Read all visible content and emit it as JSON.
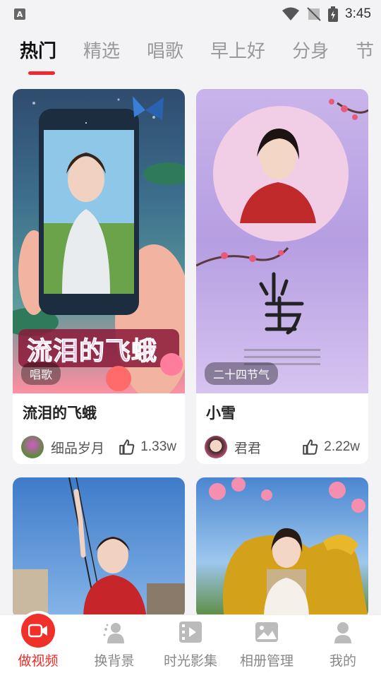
{
  "status_bar": {
    "left_icon": "A",
    "time": "3:45"
  },
  "tabs": [
    {
      "label": "热门",
      "active": true
    },
    {
      "label": "精选",
      "active": false
    },
    {
      "label": "唱歌",
      "active": false
    },
    {
      "label": "早上好",
      "active": false
    },
    {
      "label": "分身",
      "active": false
    },
    {
      "label": "节",
      "active": false
    }
  ],
  "cards": [
    {
      "title": "流泪的飞蛾",
      "tag": "唱歌",
      "author": "细品岁月",
      "likes": "1.33w",
      "overlay_text": "流泪的飞蛾"
    },
    {
      "title": "小雪",
      "tag": "二十四节气",
      "author": "君君",
      "likes": "2.22w",
      "overlay_text": "小雪"
    },
    {
      "title": "",
      "tag": "",
      "author": "",
      "likes": ""
    },
    {
      "title": "",
      "tag": "",
      "author": "",
      "likes": ""
    }
  ],
  "bottom_nav": [
    {
      "label": "做视频",
      "icon": "video-camera-icon",
      "active": true
    },
    {
      "label": "换背景",
      "icon": "person-swap-icon",
      "active": false
    },
    {
      "label": "时光影集",
      "icon": "film-icon",
      "active": false
    },
    {
      "label": "相册管理",
      "icon": "image-icon",
      "active": false
    },
    {
      "label": "我的",
      "icon": "user-icon",
      "active": false
    }
  ],
  "colors": {
    "accent": "#f0292e",
    "background": "#f3f3f6"
  }
}
